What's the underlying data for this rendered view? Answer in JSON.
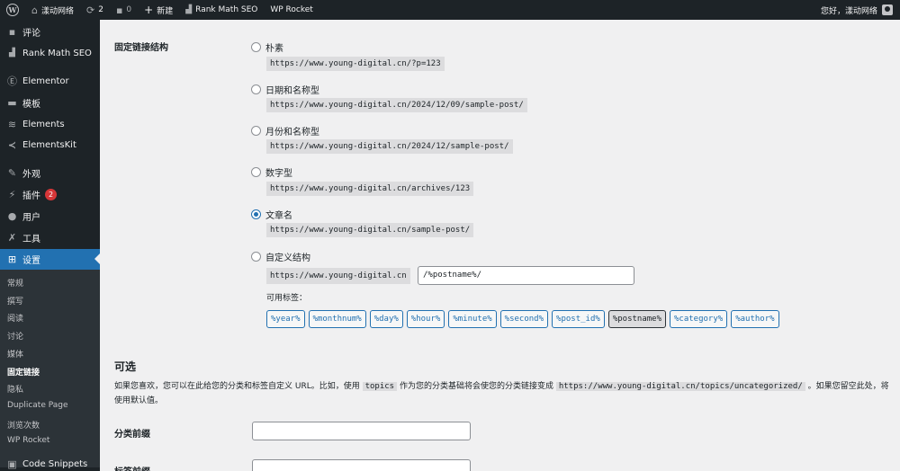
{
  "adminbar": {
    "site_name": "漾动网络",
    "updates_count": "2",
    "comments_count": "0",
    "new_label": "新建",
    "rank_math": "Rank Math SEO",
    "wp_rocket": "WP Rocket",
    "greeting": "您好，漾动网络"
  },
  "sidebar": {
    "items": [
      {
        "label": "评论",
        "icon": "comment-icon"
      },
      {
        "label": "Rank Math SEO",
        "icon": "rank-math-icon"
      },
      {
        "label": "Elementor",
        "icon": "elementor-icon"
      },
      {
        "label": "模板",
        "icon": "folder-icon"
      },
      {
        "label": "Elements",
        "icon": "elements-icon"
      },
      {
        "label": "ElementsKit",
        "icon": "elementskit-icon"
      },
      {
        "label": "外观",
        "icon": "brush-icon"
      },
      {
        "label": "插件",
        "icon": "plugin-icon",
        "badge": "2"
      },
      {
        "label": "用户",
        "icon": "user-icon"
      },
      {
        "label": "工具",
        "icon": "wrench-icon"
      },
      {
        "label": "设置",
        "icon": "settings-icon"
      },
      {
        "label": "Code Snippets",
        "icon": "code-icon"
      }
    ],
    "submenu": [
      "常规",
      "撰写",
      "阅读",
      "讨论",
      "媒体",
      "固定链接",
      "隐私",
      "Duplicate Page",
      "浏览次数",
      "WP Rocket"
    ]
  },
  "permalink": {
    "heading": "固定链接结构",
    "options": [
      {
        "label": "朴素",
        "example": "https://www.young-digital.cn/?p=123"
      },
      {
        "label": "日期和名称型",
        "example": "https://www.young-digital.cn/2024/12/09/sample-post/"
      },
      {
        "label": "月份和名称型",
        "example": "https://www.young-digital.cn/2024/12/sample-post/"
      },
      {
        "label": "数字型",
        "example": "https://www.young-digital.cn/archives/123"
      },
      {
        "label": "文章名",
        "example": "https://www.young-digital.cn/sample-post/"
      },
      {
        "label": "自定义结构"
      }
    ],
    "custom_base": "https://www.young-digital.cn",
    "custom_value": "/%postname%/",
    "available_tags_label": "可用标签：",
    "tags": [
      "%year%",
      "%monthnum%",
      "%day%",
      "%hour%",
      "%minute%",
      "%second%",
      "%post_id%",
      "%postname%",
      "%category%",
      "%author%"
    ]
  },
  "optional": {
    "title": "可选",
    "desc_1": "如果您喜欢，您可以在此给您的分类和标签自定义 URL。比如，使用 ",
    "desc_code_1": "topics",
    "desc_2": " 作为您的分类基础将会使您的分类链接变成 ",
    "desc_code_2": "https://www.young-digital.cn/topics/uncategorized/",
    "desc_3": " 。如果您留空此处，将使用默认值。",
    "category_base_label": "分类前缀",
    "tag_base_label": "标签前缀"
  }
}
